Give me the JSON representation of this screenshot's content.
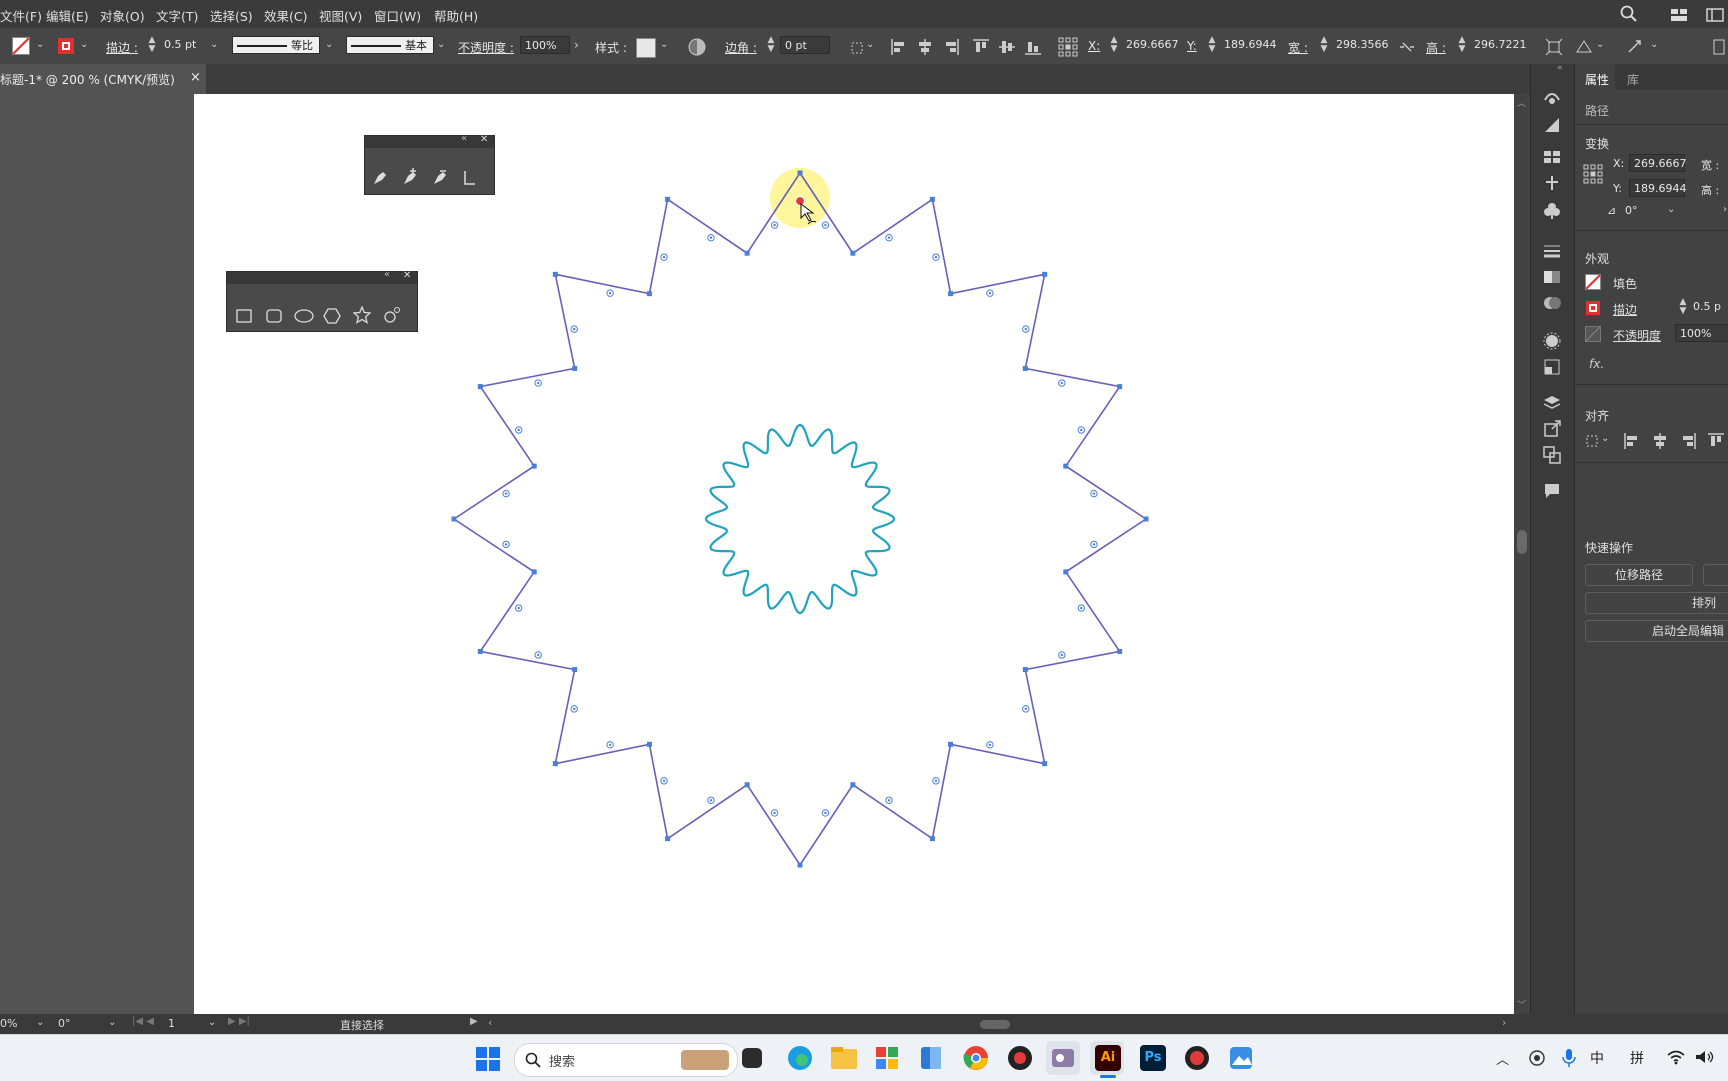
{
  "menu": [
    "文件(F)",
    "编辑(E)",
    "对象(O)",
    "文字(T)",
    "选择(S)",
    "效果(C)",
    "视图(V)",
    "窗口(W)",
    "帮助(H)"
  ],
  "control": {
    "stroke_label": "描边 :",
    "stroke_value": "0.5 pt",
    "profile_label": "等比",
    "brush_label": "基本",
    "opacity_label": "不透明度 :",
    "opacity_value": "100%",
    "style_label": "样式 :",
    "corner_label": "边角 :",
    "corner_value": "0 pt",
    "x_label": "X:",
    "x_value": "269.6667",
    "y_label": "Y:",
    "y_value": "189.6944",
    "w_label": "宽 :",
    "w_value": "298.3566",
    "h_label": "高 :",
    "h_value": "296.7221"
  },
  "doc_tab": {
    "title": "标题-1* @ 200 % (CMYK/预览)",
    "close": "×"
  },
  "properties": {
    "tabs": [
      "属性",
      "库"
    ],
    "object_type": "路径",
    "transform_title": "变换",
    "x_label": "X:",
    "x_value": "269.6667",
    "y_label": "Y:",
    "y_value": "189.6944",
    "w_label": "宽 :",
    "h_label": "高 :",
    "angle_value": "0°",
    "appearance_title": "外观",
    "fill_label": "填色",
    "stroke_label": "描边",
    "stroke_value": "0.5 p",
    "opacity_label": "不透明度",
    "opacity_value": "100%",
    "fx_label": "fx.",
    "align_title": "对齐",
    "quick_title": "快速操作",
    "offset_path_button": "位移路径",
    "arrange_button": "排列",
    "global_edit_button": "启动全局编辑"
  },
  "status": {
    "zoom": "0%",
    "rotation": "0°",
    "artboard": "1",
    "tool": "直接选择"
  },
  "taskbar": {
    "search_placeholder": "搜索",
    "tray_ime_1": "中",
    "tray_ime_2": "拼",
    "ai_label": "Ai",
    "ps_label": "Ps"
  },
  "colors": {
    "star_stroke": "#6a5fb8",
    "anchor": "#4a7fd8",
    "wave_stroke": "#1fa3bf",
    "highlight": "#fff59a",
    "cursor_dot": "#e23a3a"
  }
}
